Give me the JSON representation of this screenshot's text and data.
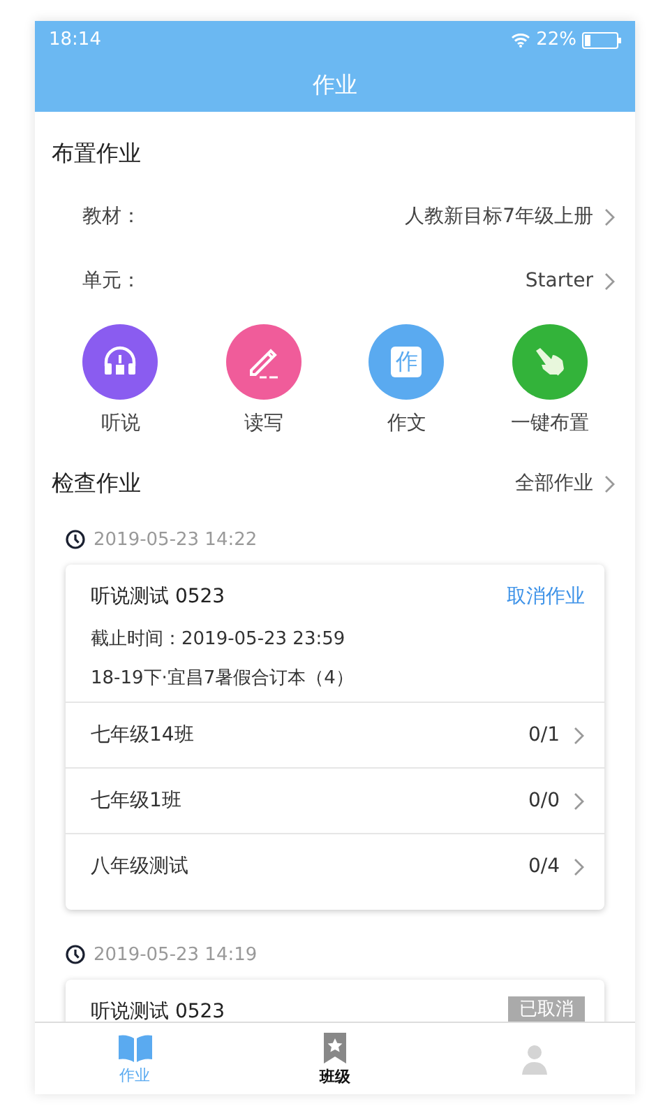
{
  "status_bar": {
    "time": "18:14",
    "battery": "22%"
  },
  "header": {
    "title": "作业"
  },
  "assign": {
    "title": "布置作业",
    "rows": [
      {
        "label": "教材：",
        "value": "人教新目标7年级上册"
      },
      {
        "label": "单元：",
        "value": "Starter"
      }
    ],
    "actions": [
      {
        "kind": "headphones",
        "label": "听说",
        "color": "#8a5cf0"
      },
      {
        "kind": "pencil",
        "label": "读写",
        "color": "#f05c9a"
      },
      {
        "kind": "glyph",
        "glyph": "作",
        "label": "作文",
        "color": "#5aaaf0"
      },
      {
        "kind": "hand",
        "label": "一键布置",
        "color": "#33b33a"
      }
    ]
  },
  "check": {
    "title": "检查作业",
    "link": "全部作业",
    "groups": [
      {
        "time": "2019-05-23 14:22",
        "title": "听说测试 0523",
        "status": {
          "kind": "link",
          "text": "取消作业"
        },
        "deadline": "截止时间：2019-05-23 23:59",
        "book": "18-19下·宜昌7暑假合订本（4）",
        "classes": [
          {
            "name": "七年级14班",
            "count": "0/1"
          },
          {
            "name": "七年级1班",
            "count": "0/0"
          },
          {
            "name": "八年级测试",
            "count": "0/4"
          }
        ]
      },
      {
        "time": "2019-05-23 14:19",
        "title": "听说测试 0523",
        "status": {
          "kind": "badge",
          "text": "已取消"
        }
      }
    ]
  },
  "tabs": [
    {
      "kind": "book",
      "label": "作业",
      "selected": true
    },
    {
      "kind": "bookmark",
      "label": "班级",
      "selected": false
    },
    {
      "kind": "person",
      "selected": false
    }
  ]
}
